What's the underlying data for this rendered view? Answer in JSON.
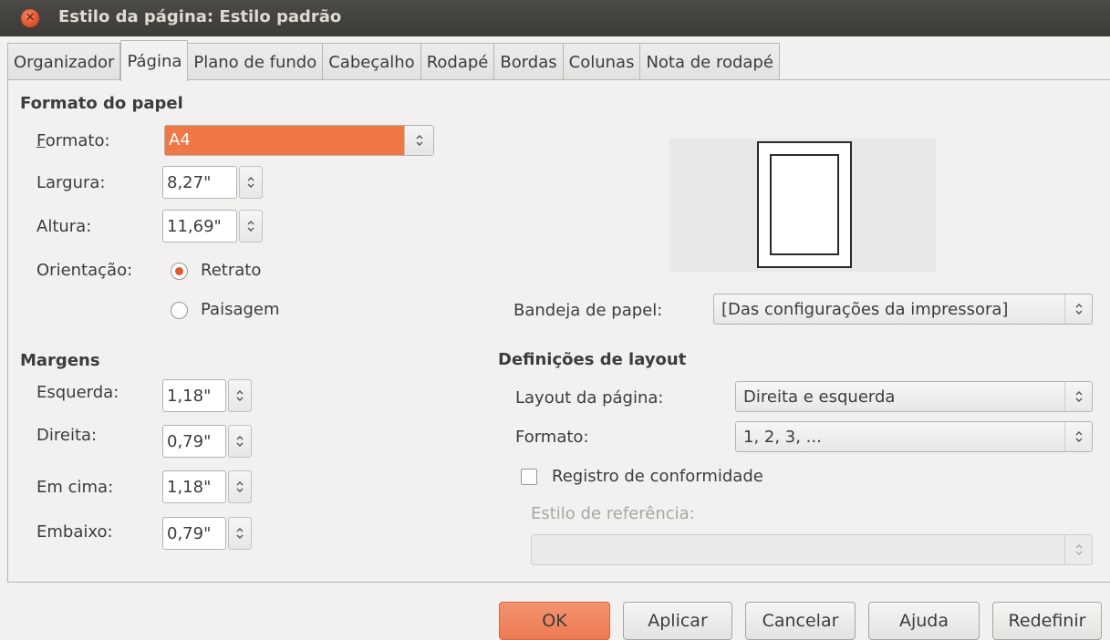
{
  "window": {
    "title": "Estilo da página: Estilo padrão"
  },
  "tabs": [
    {
      "label": "Organizador"
    },
    {
      "label": "Página"
    },
    {
      "label": "Plano de fundo"
    },
    {
      "label": "Cabeçalho"
    },
    {
      "label": "Rodapé"
    },
    {
      "label": "Bordas"
    },
    {
      "label": "Colunas"
    },
    {
      "label": "Nota de rodapé"
    }
  ],
  "active_tab": "Página",
  "paper_format": {
    "heading": "Formato do papel",
    "format_label": "Formato:",
    "format_value": "A4",
    "width_label": "Largura:",
    "width_value": "8,27\"",
    "height_label": "Altura:",
    "height_value": "11,69\"",
    "orientation_label": "Orientação:",
    "portrait_label": "Retrato",
    "landscape_label": "Paisagem",
    "orientation_selected": "Retrato"
  },
  "margins": {
    "heading": "Margens",
    "left_label": "Esquerda:",
    "left_value": "1,18\"",
    "right_label": "Direita:",
    "right_value": "0,79\"",
    "top_label": "Em cima:",
    "top_value": "1,18\"",
    "bottom_label": "Embaixo:",
    "bottom_value": "0,79\""
  },
  "paper_tray": {
    "label": "Bandeja de papel:",
    "value": "[Das configurações da impressora]"
  },
  "layout": {
    "heading": "Definições de layout",
    "page_layout_label": "Layout da página:",
    "page_layout_value": "Direita e esquerda",
    "format_label": "Formato:",
    "format_value": "1, 2, 3, ...",
    "register_label": "Registro de conformidade",
    "register_checked": false,
    "reference_style_label": "Estilo de referência:",
    "reference_style_value": ""
  },
  "buttons": {
    "ok": "OK",
    "apply": "Aplicar",
    "cancel": "Cancelar",
    "help": "Ajuda",
    "reset": "Redefinir"
  },
  "colors": {
    "accent": "#f07746",
    "titlebar": "#3c3b37",
    "background": "#f2f1f0"
  }
}
